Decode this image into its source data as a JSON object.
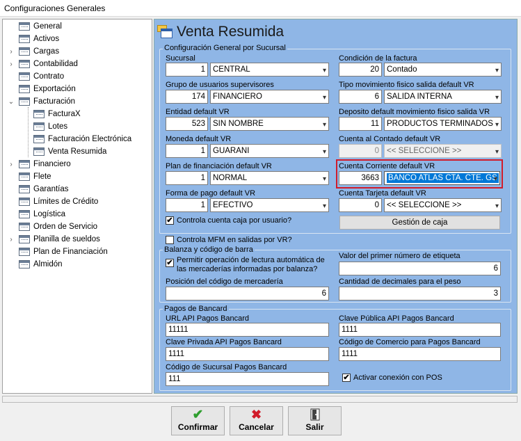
{
  "window": {
    "title": "Configuraciones Generales"
  },
  "tree": {
    "items": [
      {
        "label": "General"
      },
      {
        "label": "Activos"
      },
      {
        "label": "Cargas"
      },
      {
        "label": "Contabilidad"
      },
      {
        "label": "Contrato"
      },
      {
        "label": "Exportación"
      },
      {
        "label": "Facturación"
      },
      {
        "label": "FacturaX"
      },
      {
        "label": "Lotes"
      },
      {
        "label": "Facturación Electrónica"
      },
      {
        "label": "Venta Resumida"
      },
      {
        "label": "Financiero"
      },
      {
        "label": "Flete"
      },
      {
        "label": "Garantías"
      },
      {
        "label": "Límites de Crédito"
      },
      {
        "label": "Logística"
      },
      {
        "label": "Orden de Servicio"
      },
      {
        "label": "Planilla de sueldos"
      },
      {
        "label": "Plan de Financiación"
      },
      {
        "label": "Almidón"
      }
    ]
  },
  "page": {
    "title": "Venta Resumida"
  },
  "general": {
    "group_label": "Configuración General por Sucursal",
    "sucursal": {
      "label": "Sucursal",
      "code": "1",
      "value": "CENTRAL"
    },
    "condicion": {
      "label": "Condición de la factura",
      "code": "20",
      "value": "Contado"
    },
    "grupo": {
      "label": "Grupo de usuarios supervisores",
      "code": "174",
      "value": "FINANCIERO"
    },
    "tipo_mov": {
      "label": "Tipo movimiento fisico salida default VR",
      "code": "6",
      "value": "SALIDA INTERNA"
    },
    "entidad": {
      "label": "Entidad default VR",
      "code": "523",
      "value": "SIN NOMBRE"
    },
    "deposito": {
      "label": "Deposito default movimiento fisico salida VR",
      "code": "11",
      "value": "PRODUCTOS TERMINADOS"
    },
    "moneda": {
      "label": "Moneda default VR",
      "code": "1",
      "value": "GUARANI"
    },
    "cuenta_contado": {
      "label": "Cuenta al Contado default VR",
      "code": "0",
      "value": "<< SELECCIONE >>"
    },
    "plan": {
      "label": "Plan de financiación default VR",
      "code": "1",
      "value": "NORMAL"
    },
    "cuenta_corriente": {
      "label": "Cuenta Corriente default VR",
      "code": "3663",
      "value": "BANCO ATLAS CTA. CTE. GS"
    },
    "forma_pago": {
      "label": "Forma de pago default VR",
      "code": "1",
      "value": "EFECTIVO"
    },
    "cuenta_tarjeta": {
      "label": "Cuenta Tarjeta default VR",
      "code": "0",
      "value": "<< SELECCIONE >>"
    },
    "controla_caja": {
      "label": "Controla cuenta caja por usuario?",
      "checked": true
    },
    "gestion_caja": {
      "label": "Gestión de caja"
    }
  },
  "controla_mfm": {
    "label": "Controla MFM en salidas por VR?",
    "checked": false
  },
  "balanza": {
    "group_label": "Balanza y código de barra",
    "permitir": {
      "label_line1": "Permitir operación de lectura automática de",
      "label_line2": "las mercaderías informadas por balanza?",
      "checked": true
    },
    "valor_primer": {
      "label": "Valor del primer número de etiqueta",
      "value": "6"
    },
    "posicion": {
      "label": "Posición del código de mercadería",
      "value": "6"
    },
    "decimales": {
      "label": "Cantidad de decimales para el peso",
      "value": "3"
    }
  },
  "bancard": {
    "group_label": "Pagos de Bancard",
    "url": {
      "label": "URL API Pagos Bancard",
      "value": "11111"
    },
    "clave_publica": {
      "label": "Clave Pública API Pagos Bancard",
      "value": "1111"
    },
    "clave_privada": {
      "label": "Clave Privada API Pagos Bancard",
      "value": "1111"
    },
    "codigo_comercio": {
      "label": "Código de Comercio para Pagos Bancard",
      "value": "1111"
    },
    "codigo_sucursal": {
      "label": "Código de Sucursal Pagos Bancard",
      "value": "111"
    },
    "activar_pos": {
      "label": "Activar conexión con POS",
      "checked": true
    }
  },
  "buttons": {
    "confirmar": "Confirmar",
    "cancelar": "Cancelar",
    "salir": "Salir"
  },
  "colors": {
    "panel_bg": "#8fb6e6",
    "selection": "#0078d7",
    "highlight_border": "#d11b2a",
    "confirm": "#2e9e2e",
    "cancel": "#d11b2a"
  },
  "icons": {
    "check": "✔",
    "cross": "✖",
    "arrow": "▾"
  }
}
